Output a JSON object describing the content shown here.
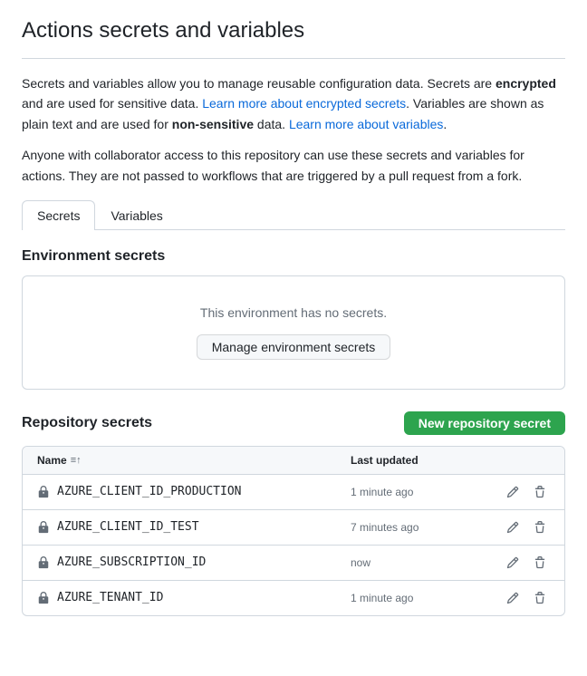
{
  "page": {
    "title": "Actions secrets and variables",
    "description1_plain": "Secrets and variables allow you to manage reusable configuration data. Secrets are ",
    "description1_bold": "encrypted",
    "description1_after": " and are used for sensitive data. ",
    "link1_text": "Learn more about encrypted secrets",
    "description1_middle": ". Variables are shown as plain text and are used for ",
    "description1_bold2": "non-sensitive",
    "description1_end": " data. ",
    "link2_text": "Learn more about variables",
    "description2": "Anyone with collaborator access to this repository can use these secrets and variables for actions. They are not passed to workflows that are triggered by a pull request from a fork."
  },
  "tabs": [
    {
      "id": "secrets",
      "label": "Secrets",
      "active": true
    },
    {
      "id": "variables",
      "label": "Variables",
      "active": false
    }
  ],
  "environment_secrets": {
    "section_title": "Environment secrets",
    "empty_message": "This environment has no secrets.",
    "manage_button_label": "Manage environment secrets"
  },
  "repository_secrets": {
    "section_title": "Repository secrets",
    "new_button_label": "New repository secret",
    "table": {
      "col_name": "Name",
      "col_sort_icon": "≡↑",
      "col_updated": "Last updated",
      "rows": [
        {
          "name": "AZURE_CLIENT_ID_PRODUCTION",
          "updated": "1 minute ago"
        },
        {
          "name": "AZURE_CLIENT_ID_TEST",
          "updated": "7 minutes ago"
        },
        {
          "name": "AZURE_SUBSCRIPTION_ID",
          "updated": "now"
        },
        {
          "name": "AZURE_TENANT_ID",
          "updated": "1 minute ago"
        }
      ]
    }
  },
  "colors": {
    "new_secret_bg": "#2da44e",
    "link_color": "#0969da"
  }
}
